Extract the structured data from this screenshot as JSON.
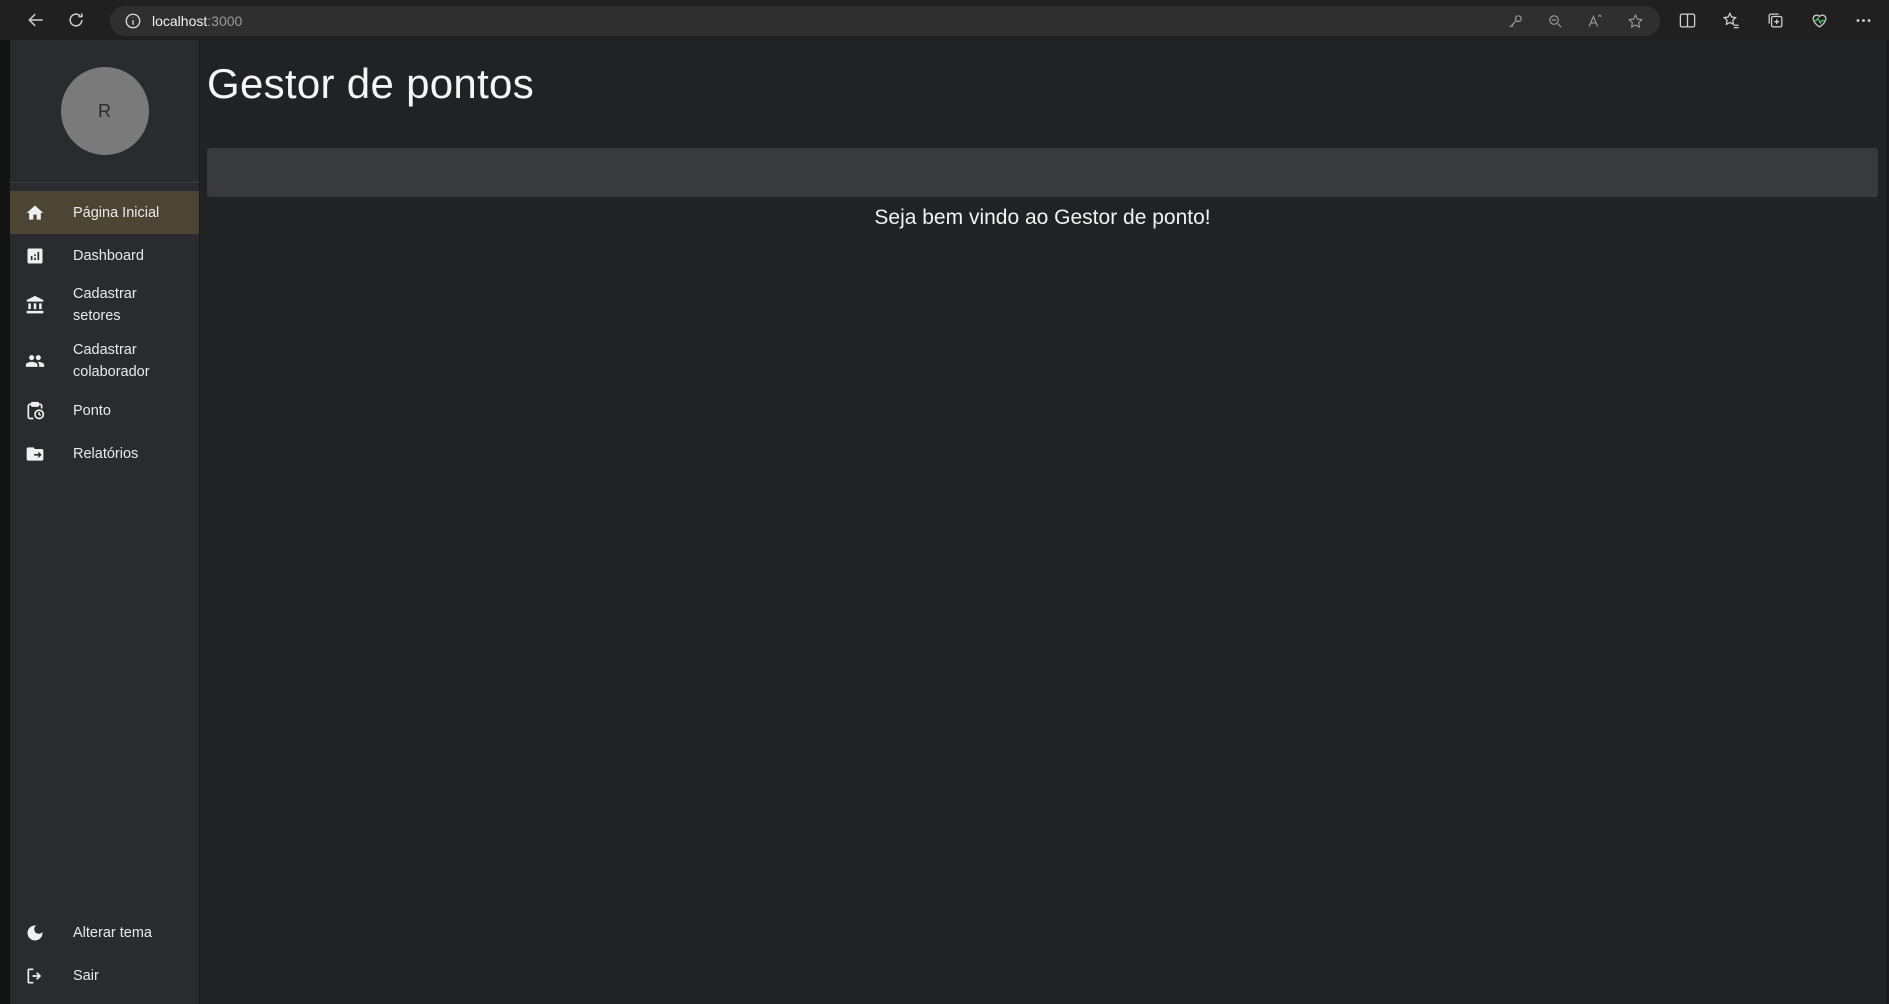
{
  "browser": {
    "url_host": "localhost",
    "url_port": ":3000"
  },
  "sidebar": {
    "avatar_initial": "R",
    "items": [
      {
        "label": "Página Inicial",
        "icon": "home-icon",
        "active": true
      },
      {
        "label": "Dashboard",
        "icon": "chart-icon",
        "active": false
      },
      {
        "label": "Cadastrar setores",
        "icon": "bank-icon",
        "active": false
      },
      {
        "label": "Cadastrar colaborador",
        "icon": "people-icon",
        "active": false
      },
      {
        "label": "Ponto",
        "icon": "clipboard-clock-icon",
        "active": false
      },
      {
        "label": "Relatórios",
        "icon": "folder-arrow-icon",
        "active": false
      }
    ],
    "bottom_items": [
      {
        "label": "Alterar tema",
        "icon": "moon-icon"
      },
      {
        "label": "Sair",
        "icon": "logout-icon"
      }
    ]
  },
  "main": {
    "title": "Gestor de pontos",
    "welcome": "Seja bem vindo ao Gestor de ponto!"
  },
  "colors": {
    "background": "#212226",
    "sidebar": "#2a2b2e",
    "active_item": "#4c4533",
    "panel": "#393a3d"
  }
}
